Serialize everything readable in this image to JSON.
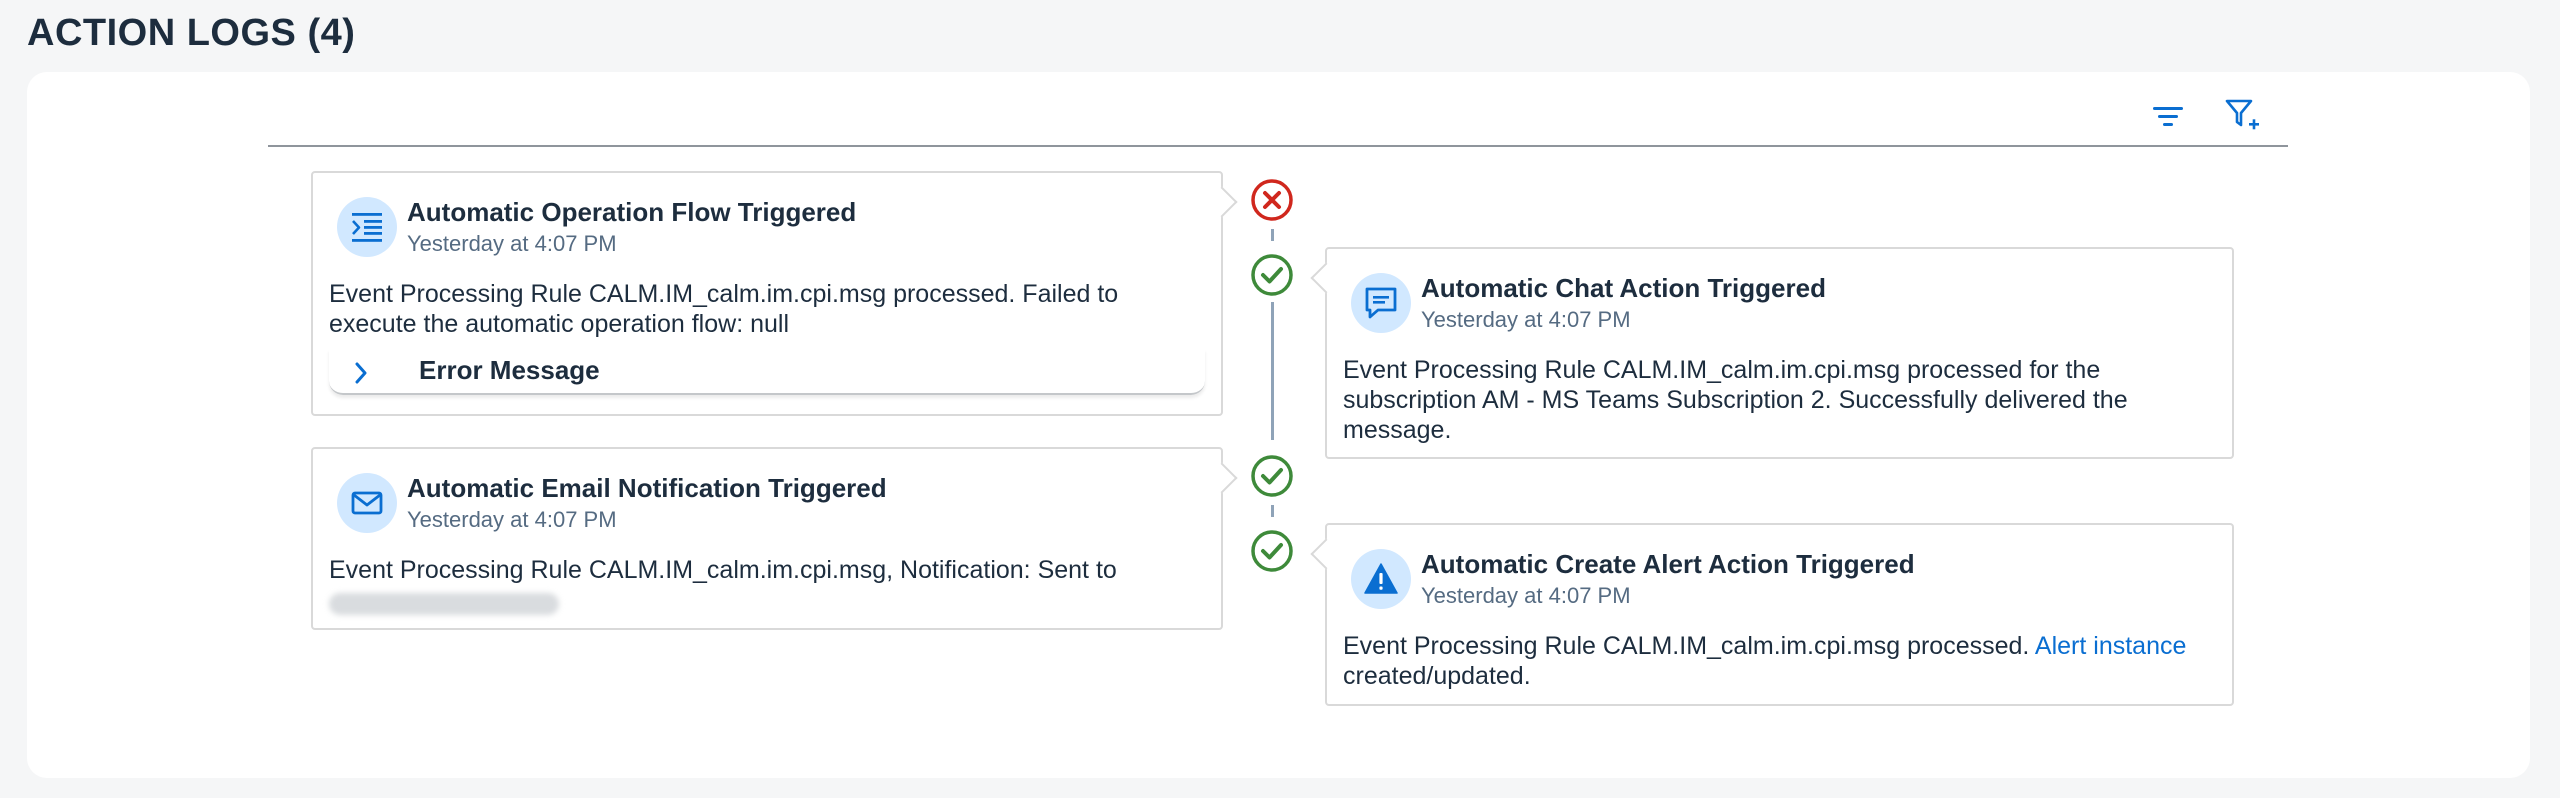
{
  "header": {
    "title": "ACTION LOGS (4)"
  },
  "toolbar": {
    "sort_icon": "sort-lines-icon",
    "filter_icon": "filter-add-icon"
  },
  "colors": {
    "error": "#d0271d",
    "success": "#3e8a3a",
    "accent": "#0a6ed1",
    "avatar_bg": "#d1e8ff"
  },
  "logs": [
    {
      "title": "Automatic Operation Flow Triggered",
      "time": "Yesterday at 4:07 PM",
      "body": "Event Processing Rule CALM.IM_calm.im.cpi.msg processed. Failed to execute the automatic operation flow: null",
      "expander_label": "Error Message",
      "icon": "operation-flow-icon",
      "status": "error"
    },
    {
      "title": "Automatic Chat Action Triggered",
      "time": "Yesterday at 4:07 PM",
      "body": "Event Processing Rule CALM.IM_calm.im.cpi.msg processed for the subscription AM - MS Teams Subscription 2. Successfully delivered the message.",
      "icon": "chat-icon",
      "status": "success"
    },
    {
      "title": "Automatic Email Notification Triggered",
      "time": "Yesterday at 4:07 PM",
      "body": "Event Processing Rule CALM.IM_calm.im.cpi.msg, Notification: Sent to",
      "icon": "email-icon",
      "status": "success"
    },
    {
      "title": "Automatic Create Alert Action Triggered",
      "time": "Yesterday at 4:07 PM",
      "body_prefix": "Event Processing Rule CALM.IM_calm.im.cpi.msg processed. ",
      "link_text": "Alert instance",
      "body_suffix": "created/updated.",
      "icon": "alert-icon",
      "status": "success"
    }
  ]
}
